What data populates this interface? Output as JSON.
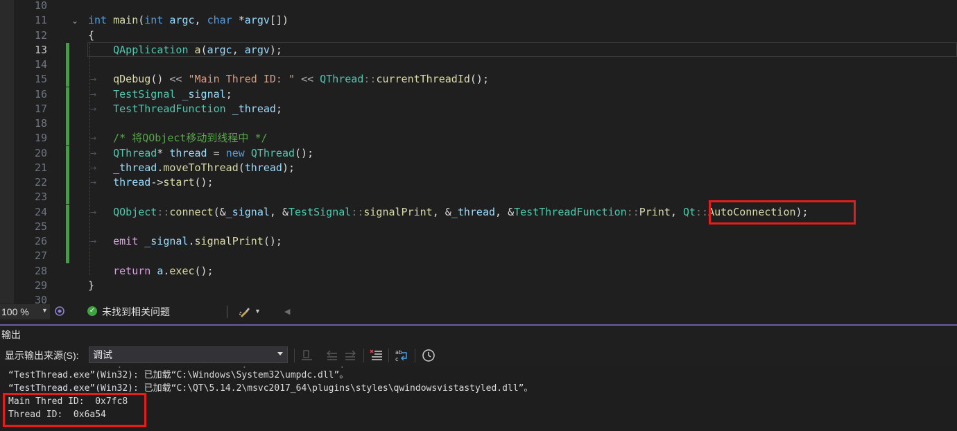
{
  "editor": {
    "lines": [
      {
        "num": "10"
      },
      {
        "num": "11",
        "tokens": [
          [
            "kw",
            "int"
          ],
          [
            "pl",
            " "
          ],
          [
            "fn",
            "main"
          ],
          [
            "pl",
            "("
          ],
          [
            "kw",
            "int"
          ],
          [
            "pl",
            " "
          ],
          [
            "var",
            "argc"
          ],
          [
            "pl",
            ", "
          ],
          [
            "kw",
            "char"
          ],
          [
            "pl",
            " *"
          ],
          [
            "var",
            "argv"
          ],
          [
            "pl",
            "[])"
          ]
        ]
      },
      {
        "num": "12",
        "tokens": [
          [
            "pl",
            "{"
          ]
        ]
      },
      {
        "num": "13",
        "tokens": [
          [
            "pl",
            "    "
          ],
          [
            "ty",
            "QApplication"
          ],
          [
            "pl",
            " "
          ],
          [
            "fn",
            "a"
          ],
          [
            "pl",
            "("
          ],
          [
            "var",
            "argc"
          ],
          [
            "pl",
            ", "
          ],
          [
            "var",
            "argv"
          ],
          [
            "pl",
            ");"
          ]
        ]
      },
      {
        "num": "14"
      },
      {
        "num": "15",
        "tokens": [
          [
            "pl",
            "    "
          ],
          [
            "fn",
            "qDebug"
          ],
          [
            "pl",
            "() "
          ],
          [
            "op",
            "<<"
          ],
          [
            "pl",
            " "
          ],
          [
            "str",
            "\"Main Thred ID: \""
          ],
          [
            "pl",
            " "
          ],
          [
            "op",
            "<<"
          ],
          [
            "pl",
            " "
          ],
          [
            "ty",
            "QThread"
          ],
          [
            "sep",
            "::"
          ],
          [
            "fn",
            "currentThreadId"
          ],
          [
            "pl",
            "();"
          ]
        ]
      },
      {
        "num": "16",
        "tokens": [
          [
            "pl",
            "    "
          ],
          [
            "ty",
            "TestSignal"
          ],
          [
            "pl",
            " "
          ],
          [
            "var",
            "_signal"
          ],
          [
            "pl",
            ";"
          ]
        ]
      },
      {
        "num": "17",
        "tokens": [
          [
            "pl",
            "    "
          ],
          [
            "ty",
            "TestThreadFunction"
          ],
          [
            "pl",
            " "
          ],
          [
            "var",
            "_thread"
          ],
          [
            "pl",
            ";"
          ]
        ]
      },
      {
        "num": "18"
      },
      {
        "num": "19",
        "tokens": [
          [
            "pl",
            "    "
          ],
          [
            "com",
            "/* 将QObject移动到线程中 */"
          ]
        ]
      },
      {
        "num": "20",
        "tokens": [
          [
            "pl",
            "    "
          ],
          [
            "ty",
            "QThread"
          ],
          [
            "pl",
            "* "
          ],
          [
            "var",
            "thread"
          ],
          [
            "pl",
            " = "
          ],
          [
            "kw",
            "new"
          ],
          [
            "pl",
            " "
          ],
          [
            "ty",
            "QThread"
          ],
          [
            "pl",
            "();"
          ]
        ]
      },
      {
        "num": "21",
        "tokens": [
          [
            "pl",
            "    "
          ],
          [
            "var",
            "_thread"
          ],
          [
            "pl",
            "."
          ],
          [
            "fn",
            "moveToThread"
          ],
          [
            "pl",
            "("
          ],
          [
            "var",
            "thread"
          ],
          [
            "pl",
            ");"
          ]
        ]
      },
      {
        "num": "22",
        "tokens": [
          [
            "pl",
            "    "
          ],
          [
            "var",
            "thread"
          ],
          [
            "pl",
            "->"
          ],
          [
            "fn",
            "start"
          ],
          [
            "pl",
            "();"
          ]
        ]
      },
      {
        "num": "23"
      },
      {
        "num": "24",
        "tokens": [
          [
            "pl",
            "    "
          ],
          [
            "ty",
            "QObject"
          ],
          [
            "sep",
            "::"
          ],
          [
            "fn",
            "connect"
          ],
          [
            "pl",
            "(&"
          ],
          [
            "var",
            "_signal"
          ],
          [
            "pl",
            ", &"
          ],
          [
            "ty",
            "TestSignal"
          ],
          [
            "sep",
            "::"
          ],
          [
            "fn",
            "signalPrint"
          ],
          [
            "pl",
            ", &"
          ],
          [
            "var",
            "_thread"
          ],
          [
            "pl",
            ", &"
          ],
          [
            "ty",
            "TestThreadFunction"
          ],
          [
            "sep",
            "::"
          ],
          [
            "fn",
            "Print"
          ],
          [
            "pl",
            ", "
          ],
          [
            "ty",
            "Qt"
          ],
          [
            "sep",
            "::"
          ],
          [
            "fn",
            "AutoConnection"
          ],
          [
            "pl",
            ");"
          ]
        ]
      },
      {
        "num": "25"
      },
      {
        "num": "26",
        "tokens": [
          [
            "pl",
            "    "
          ],
          [
            "ctl",
            "emit"
          ],
          [
            "pl",
            " "
          ],
          [
            "var",
            "_signal"
          ],
          [
            "pl",
            "."
          ],
          [
            "fn",
            "signalPrint"
          ],
          [
            "pl",
            "();"
          ]
        ]
      },
      {
        "num": "27"
      },
      {
        "num": "28",
        "tokens": [
          [
            "pl",
            "    "
          ],
          [
            "ctl",
            "return"
          ],
          [
            "pl",
            " "
          ],
          [
            "var",
            "a"
          ],
          [
            "pl",
            "."
          ],
          [
            "fn",
            "exec"
          ],
          [
            "pl",
            "();"
          ]
        ]
      },
      {
        "num": "29",
        "tokens": [
          [
            "pl",
            "}"
          ]
        ]
      },
      {
        "num": "30"
      }
    ],
    "current_line": "13",
    "modified_lines": [
      "13",
      "14",
      "15",
      "16",
      "17",
      "18",
      "19",
      "20",
      "21",
      "22",
      "23",
      "24",
      "25",
      "26",
      "27"
    ]
  },
  "status": {
    "zoom": "100 %",
    "issues_text": "未找到相关问题",
    "issues_icon": "check-circle-icon"
  },
  "output": {
    "title": "输出",
    "source_label": "显示输出来源(S):",
    "source_value": "调试",
    "lines": [
      "“TestThread.exe”(Win32): 已加载“C:\\Windows\\System32\\umpdc.dll”。",
      "“TestThread.exe”(Win32): 已加载“C:\\QT\\5.14.2\\msvc2017_64\\plugins\\styles\\qwindowsvistastyled.dll”。",
      "Main Thred ID:  0x7fc8",
      "Thread ID:  0x6a54"
    ]
  },
  "colors": {
    "highlight_box": "#e51c1c",
    "change_bar": "#3ca33c",
    "accent": "#6b5ba8"
  }
}
